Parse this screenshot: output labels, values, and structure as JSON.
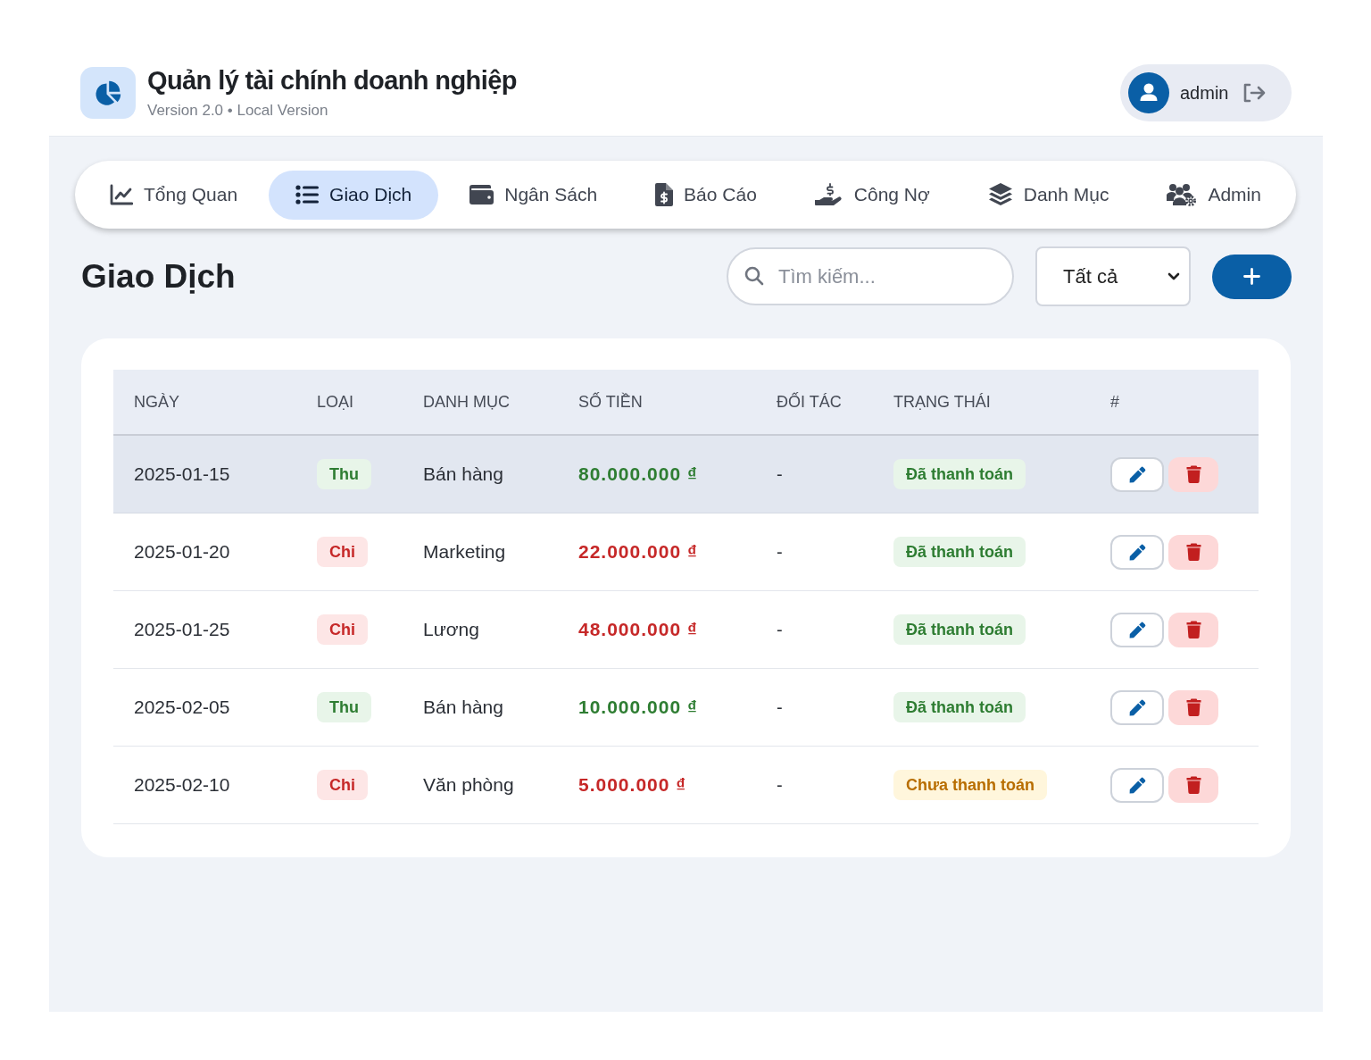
{
  "header": {
    "title": "Quản lý tài chính doanh nghiệp",
    "subtitle": "Version 2.0 • Local Version",
    "user": {
      "name": "admin"
    }
  },
  "nav": {
    "tabs": [
      {
        "label": "Tổng Quan",
        "selected": false
      },
      {
        "label": "Giao Dịch",
        "selected": true
      },
      {
        "label": "Ngân Sách",
        "selected": false
      },
      {
        "label": "Báo Cáo",
        "selected": false
      },
      {
        "label": "Công Nợ",
        "selected": false
      },
      {
        "label": "Danh Mục",
        "selected": false
      },
      {
        "label": "Admin",
        "selected": false
      }
    ]
  },
  "page": {
    "title": "Giao Dịch",
    "search": {
      "placeholder": "Tìm kiếm..."
    },
    "filter": {
      "value": "Tất cả"
    }
  },
  "table": {
    "columns": [
      "NGÀY",
      "LOẠI",
      "DANH MỤC",
      "SỐ TIỀN",
      "ĐỐI TÁC",
      "TRẠNG THÁI",
      "#"
    ],
    "rows": [
      {
        "highlighted": true,
        "kind": "income",
        "date": "2025-01-15",
        "type": "Thu",
        "category": "Bán hàng",
        "amount": "80.000.000 ₫",
        "partner": "-",
        "status": {
          "label": "Đã thanh toán",
          "kind": "paid"
        }
      },
      {
        "highlighted": false,
        "kind": "expense",
        "date": "2025-01-20",
        "type": "Chi",
        "category": "Marketing",
        "amount": "22.000.000 ₫",
        "partner": "-",
        "status": {
          "label": "Đã thanh toán",
          "kind": "paid"
        }
      },
      {
        "highlighted": false,
        "kind": "expense",
        "date": "2025-01-25",
        "type": "Chi",
        "category": "Lương",
        "amount": "48.000.000 ₫",
        "partner": "-",
        "status": {
          "label": "Đã thanh toán",
          "kind": "paid"
        }
      },
      {
        "highlighted": false,
        "kind": "income",
        "date": "2025-02-05",
        "type": "Thu",
        "category": "Bán hàng",
        "amount": "10.000.000 ₫",
        "partner": "-",
        "status": {
          "label": "Đã thanh toán",
          "kind": "paid"
        }
      },
      {
        "highlighted": false,
        "kind": "expense",
        "date": "2025-02-10",
        "type": "Chi",
        "category": "Văn phòng",
        "amount": "5.000.000 ₫",
        "partner": "-",
        "status": {
          "label": "Chưa thanh toán",
          "kind": "unpaid"
        }
      }
    ]
  }
}
